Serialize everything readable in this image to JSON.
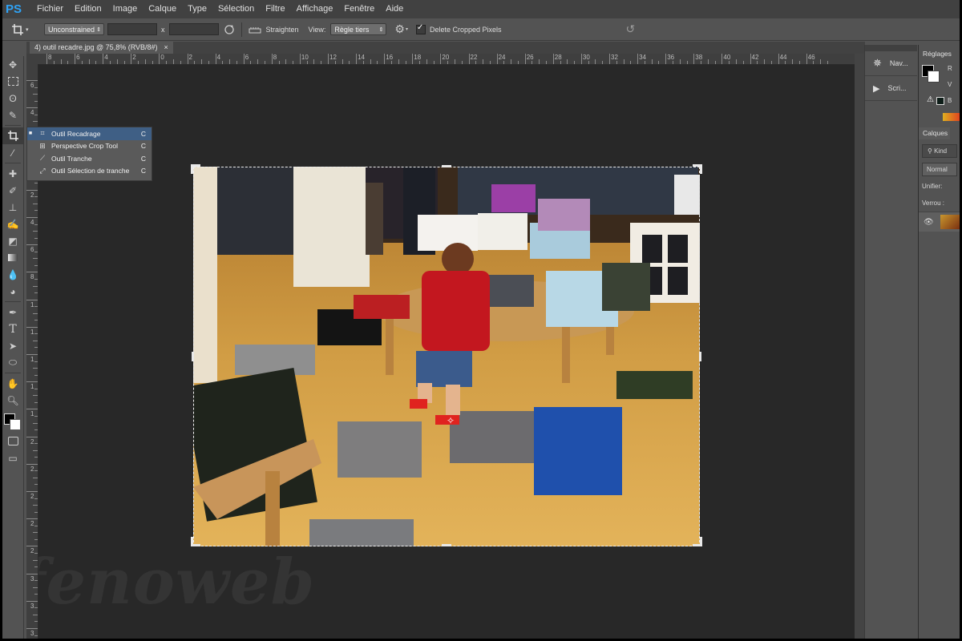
{
  "app": {
    "logo": "PS"
  },
  "menu": [
    "Fichier",
    "Edition",
    "Image",
    "Calque",
    "Type",
    "Sélection",
    "Filtre",
    "Affichage",
    "Fenêtre",
    "Aide"
  ],
  "options": {
    "ratio_value": "Unconstrained",
    "x_label": "x",
    "straighten_label": "Straighten",
    "view_label": "View:",
    "view_value": "Règle tiers",
    "delete_cropped_label": "Delete Cropped Pixels",
    "delete_cropped_checked": true
  },
  "document": {
    "tab_title": "4) outil recadre.jpg @ 75,8% (RVB/8#)",
    "close": "×"
  },
  "ruler": {
    "h_labels": [
      "8",
      "6",
      "4",
      "2",
      "0",
      "2",
      "4",
      "6",
      "8",
      "10",
      "12",
      "14",
      "16",
      "18",
      "20",
      "22",
      "24",
      "26",
      "28",
      "30",
      "32",
      "34",
      "36",
      "38",
      "40",
      "42",
      "44",
      "46"
    ],
    "v_labels": [
      "6",
      "4",
      "2",
      "0",
      "2",
      "4",
      "6",
      "8",
      "1",
      "1",
      "1",
      "1",
      "1",
      "2",
      "2",
      "2",
      "2",
      "2",
      "3",
      "3",
      "3"
    ]
  },
  "flyout": {
    "items": [
      {
        "label": "Outil Recadrage",
        "shortcut": "C",
        "selected": true
      },
      {
        "label": "Perspective Crop Tool",
        "shortcut": "C",
        "selected": false
      },
      {
        "label": "Outil Tranche",
        "shortcut": "C",
        "selected": false
      },
      {
        "label": "Outil Sélection de tranche",
        "shortcut": "C",
        "selected": false
      }
    ]
  },
  "collapsed_panels": [
    {
      "label": "Nav...",
      "icon": "navigator-icon"
    },
    {
      "label": "Scri...",
      "icon": "play-icon"
    }
  ],
  "right_panel": {
    "reglages_title": "Réglages",
    "channels": [
      "R",
      "V",
      "B"
    ],
    "layers_tab": "Calques",
    "kind_label": "Kind",
    "blend_mode": "Normal",
    "unify_label": "Unifier:",
    "lock_label": "Verrou :"
  },
  "watermark": "fenoweb",
  "colors": {
    "menu_bg": "#414141",
    "panel_bg": "#535353",
    "canvas_bg": "#282828",
    "accent_blue": "#2fa3f6",
    "selection_blue": "#3f5f85"
  }
}
